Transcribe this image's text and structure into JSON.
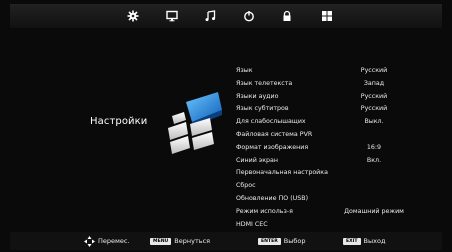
{
  "top_tabs": [
    {
      "name": "settings",
      "icon": "gear-icon"
    },
    {
      "name": "picture",
      "icon": "monitor-icon"
    },
    {
      "name": "sound",
      "icon": "music-note-icon"
    },
    {
      "name": "time",
      "icon": "power-icon"
    },
    {
      "name": "lock",
      "icon": "lock-icon"
    },
    {
      "name": "apps",
      "icon": "grid-icon"
    }
  ],
  "section": {
    "title": "Настройки"
  },
  "menu": [
    {
      "label": "Язык",
      "value": "Русский"
    },
    {
      "label": "Язык телетекста",
      "value": "Запад"
    },
    {
      "label": "Языки аудио",
      "value": "Русский"
    },
    {
      "label": "Язык субтитров",
      "value": "Русский"
    },
    {
      "label": "Для слабослышащих",
      "value": "Выкл."
    },
    {
      "label": "Файловая система PVR",
      "value": ""
    },
    {
      "label": "Формат изображения",
      "value": "16:9"
    },
    {
      "label": "Синий экран",
      "value": "Вкл."
    },
    {
      "label": "Первоначальная настройка",
      "value": ""
    },
    {
      "label": "Сброс",
      "value": ""
    },
    {
      "label": "Обновление ПО (USB)",
      "value": ""
    },
    {
      "label": "Режим использ-я",
      "value": "Домашний режим"
    },
    {
      "label": "HDMI CEC",
      "value": ""
    }
  ],
  "bottom_hints": {
    "move": {
      "label": "Перемес.",
      "icon": "dpad-icon"
    },
    "back": {
      "key": "MENU",
      "label": "Вернуться"
    },
    "select": {
      "key": "ENTER",
      "label": "Выбор"
    },
    "exit": {
      "key": "EXIT",
      "label": "Выход"
    }
  },
  "colors": {
    "accent_blue": "#1e88e5",
    "background": "#0a0a0a"
  }
}
